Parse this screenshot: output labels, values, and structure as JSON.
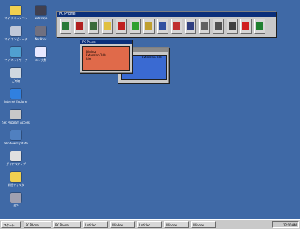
{
  "desktop": {
    "icons": [
      {
        "label": "マイ ドキュメント",
        "icon": "folder-icon",
        "color": "#f0d050"
      },
      {
        "label": "マイ コンピュータ",
        "icon": "computer-icon",
        "color": "#c0c8d8"
      },
      {
        "label": "マイ ネットワーク",
        "icon": "network-icon",
        "color": "#50a0d0"
      },
      {
        "label": "ごみ箱",
        "icon": "recycle-bin-icon",
        "color": "#d0d8e0"
      },
      {
        "label": "Internet Explorer",
        "icon": "browser-icon",
        "color": "#3080e0"
      },
      {
        "label": "Set Program Access",
        "icon": "program-access-icon",
        "color": "#c8c8c8"
      },
      {
        "label": "Windows Update",
        "icon": "update-icon",
        "color": "#5080c0"
      },
      {
        "label": "ダイヤルアップ",
        "icon": "dialup-icon",
        "color": "#e0e0e0"
      },
      {
        "label": "新規フォルダ",
        "icon": "new-folder-icon",
        "color": "#f0d050"
      },
      {
        "label": "FTP",
        "icon": "ftp-icon",
        "color": "#a0a0b0"
      },
      {
        "label": "Netscape",
        "icon": "netscape-icon",
        "color": "#404050"
      },
      {
        "label": "NetApps",
        "icon": "netapps-icon",
        "color": "#707080"
      },
      {
        "label": "二ン大数",
        "icon": "document-icon",
        "color": "#e8e8ff"
      }
    ]
  },
  "app_window": {
    "title": "PC Phone",
    "toolbar": [
      {
        "icon": "phone-icon",
        "color": "#2a7a3a"
      },
      {
        "icon": "fax-icon",
        "color": "#b02020"
      },
      {
        "icon": "network-icon",
        "color": "#3a6a3a"
      },
      {
        "icon": "lightbulb-icon",
        "color": "#e0c040"
      },
      {
        "icon": "record-icon",
        "color": "#c02020"
      },
      {
        "icon": "image-icon",
        "color": "#30a030"
      },
      {
        "icon": "folder-icon",
        "color": "#c0a030"
      },
      {
        "icon": "book-icon",
        "color": "#3050a0"
      },
      {
        "icon": "screen-icon",
        "color": "#c03030"
      },
      {
        "icon": "display-icon",
        "color": "#304080"
      },
      {
        "icon": "window-icon",
        "color": "#606060"
      },
      {
        "icon": "panel-icon",
        "color": "#505050"
      },
      {
        "icon": "frame-icon",
        "color": "#404040"
      },
      {
        "icon": "help-icon",
        "color": "#d02020"
      },
      {
        "icon": "exit-icon",
        "color": "#208030"
      }
    ]
  },
  "popup_front": {
    "title": "PC Phone",
    "lines": [
      "Dialing",
      "Extension 100",
      "Idle"
    ]
  },
  "popup_back": {
    "text": "Extension 100"
  },
  "taskbar": {
    "start_label": "スタート",
    "items": [
      "PC Phone",
      "PC Phone",
      "Untitled",
      "Window",
      "Untitled",
      "Window",
      "Window"
    ],
    "tray_time": "12:00 AM"
  }
}
